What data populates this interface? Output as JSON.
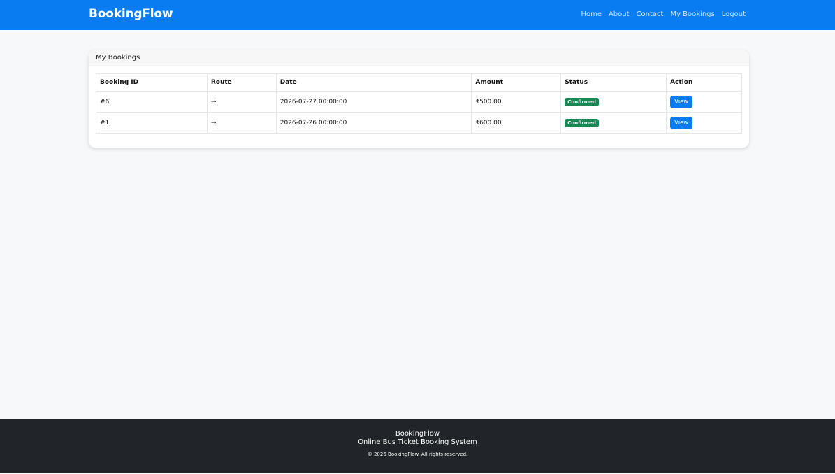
{
  "header": {
    "brand": "BookingFlow",
    "nav": [
      "Home",
      "About",
      "Contact",
      "My Bookings",
      "Logout"
    ]
  },
  "card": {
    "title": "My Bookings",
    "columns": [
      "Booking ID",
      "Route",
      "Date",
      "Amount",
      "Status",
      "Action"
    ],
    "rows": [
      {
        "id": "#6",
        "route": "→",
        "date": "2026-07-27 00:00:00",
        "amount": "₹500.00",
        "status": "Confirmed",
        "action": "View"
      },
      {
        "id": "#1",
        "route": "→",
        "date": "2026-07-26 00:00:00",
        "amount": "₹600.00",
        "status": "Confirmed",
        "action": "View"
      }
    ]
  },
  "footer": {
    "brand": "BookingFlow",
    "tagline": "Online Bus Ticket Booking System",
    "copyright": "© 2026 BookingFlow. All rights reserved."
  },
  "colors": {
    "primary": "#0a7cf2",
    "success": "#198754",
    "footer_bg": "#212529"
  }
}
